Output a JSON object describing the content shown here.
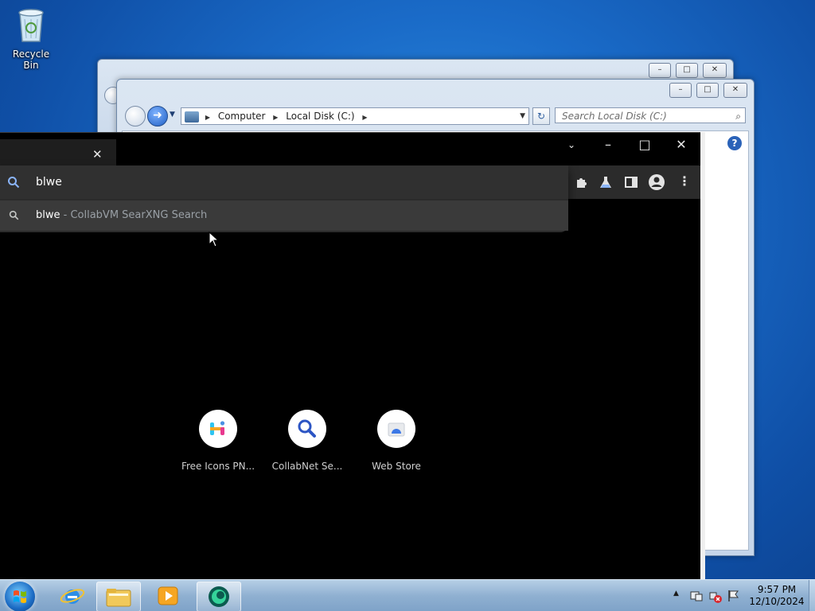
{
  "desktop": {
    "recycle_bin_label": "Recycle Bin"
  },
  "explorer": {
    "breadcrumb": [
      "Computer",
      "Local Disk (C:)"
    ],
    "search_placeholder": "Search Local Disk (C:)",
    "minimize": "–",
    "maximize": "□",
    "close": "✕"
  },
  "browser": {
    "tab_close": "✕",
    "omnibox_value": "blwe",
    "suggestion": {
      "query": "blwe",
      "source": " - CollabVM SearXNG Search"
    },
    "shortcuts": [
      {
        "title": "Free Icons PN...",
        "icon": "free-icons-logo"
      },
      {
        "title": "CollabNet Se...",
        "icon": "search-icon"
      },
      {
        "title": "Web Store",
        "icon": "web-store-icon"
      }
    ],
    "colors": {
      "background": "#000000",
      "omnibox": "#303030",
      "accent": "#8ab4f8"
    }
  },
  "taskbar": {
    "time": "9:57 PM",
    "date": "12/10/2024"
  }
}
